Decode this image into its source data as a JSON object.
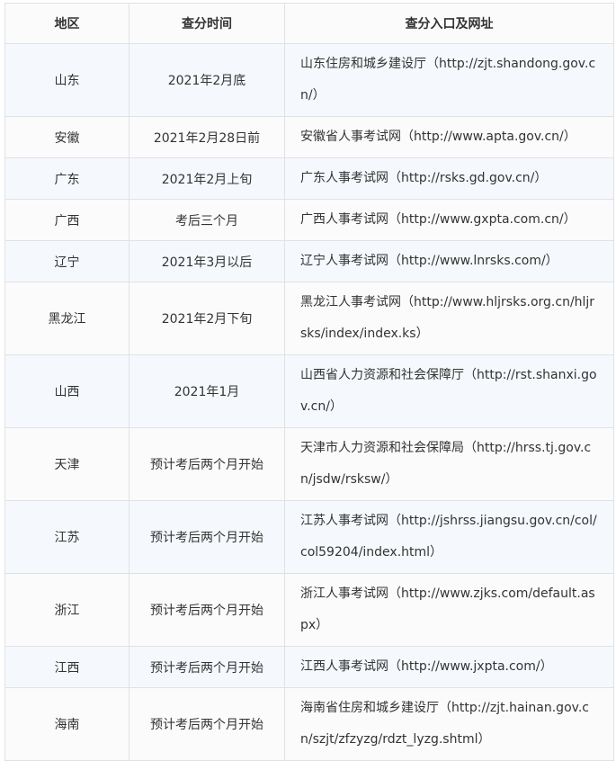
{
  "table": {
    "headers": [
      "地区",
      "查分时间",
      "查分入口及网址"
    ],
    "rows": [
      {
        "region": "山东",
        "time": "2021年2月底",
        "portal": "山东住房和城乡建设厅（http://zjt.shandong.gov.cn/）"
      },
      {
        "region": "安徽",
        "time": "2021年2月28日前",
        "portal": "安徽省人事考试网（http://www.apta.gov.cn/）"
      },
      {
        "region": "广东",
        "time": "2021年2月上旬",
        "portal": "广东人事考试网（http://rsks.gd.gov.cn/）"
      },
      {
        "region": "广西",
        "time": "考后三个月",
        "portal": "广西人事考试网（http://www.gxpta.com.cn/）"
      },
      {
        "region": "辽宁",
        "time": "2021年3月以后",
        "portal": "辽宁人事考试网（http://www.lnrsks.com/）"
      },
      {
        "region": "黑龙江",
        "time": "2021年2月下旬",
        "portal": "黑龙江人事考试网（http://www.hljrsks.org.cn/hljrsks/index/index.ks）"
      },
      {
        "region": "山西",
        "time": "2021年1月",
        "portal": "山西省人力资源和社会保障厅（http://rst.shanxi.gov.cn/）"
      },
      {
        "region": "天津",
        "time": "预计考后两个月开始",
        "portal": "天津市人力资源和社会保障局（http://hrss.tj.gov.cn/jsdw/rsksw/）"
      },
      {
        "region": "江苏",
        "time": "预计考后两个月开始",
        "portal": "江苏人事考试网（http://jshrss.jiangsu.gov.cn/col/col59204/index.html）"
      },
      {
        "region": "浙江",
        "time": "预计考后两个月开始",
        "portal": "浙江人事考试网（http://www.zjks.com/default.aspx）"
      },
      {
        "region": "江西",
        "time": "预计考后两个月开始",
        "portal": "江西人事考试网（http://www.jxpta.com/）"
      },
      {
        "region": "海南",
        "time": "预计考后两个月开始",
        "portal": "海南省住房和城乡建设厅（http://zjt.hainan.gov.cn/szjt/zfzyzg/rdzt_lyzg.shtml）"
      }
    ]
  }
}
